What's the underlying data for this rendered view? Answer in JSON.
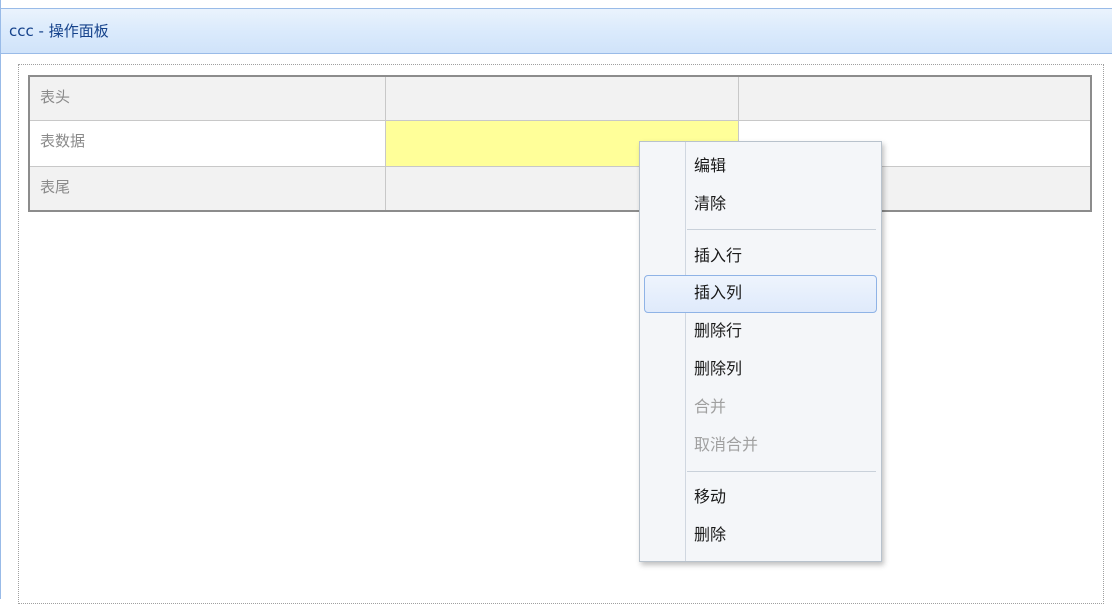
{
  "panel": {
    "title": "ccc - 操作面板"
  },
  "grid": {
    "rows": [
      {
        "cells": [
          "表头",
          "",
          ""
        ]
      },
      {
        "cells": [
          "表数据",
          "",
          ""
        ]
      },
      {
        "cells": [
          "表尾",
          "",
          ""
        ]
      }
    ],
    "selected_cell_color": "#ffff99"
  },
  "context_menu": {
    "items": [
      {
        "label": "编辑",
        "enabled": true
      },
      {
        "label": "清除",
        "enabled": true
      },
      {
        "label": "插入行",
        "enabled": true
      },
      {
        "label": "插入列",
        "enabled": true,
        "highlighted": true
      },
      {
        "label": "删除行",
        "enabled": true
      },
      {
        "label": "删除列",
        "enabled": true
      },
      {
        "label": "合并",
        "enabled": false
      },
      {
        "label": "取消合并",
        "enabled": false
      },
      {
        "label": "移动",
        "enabled": true
      },
      {
        "label": "删除",
        "enabled": true
      }
    ]
  }
}
